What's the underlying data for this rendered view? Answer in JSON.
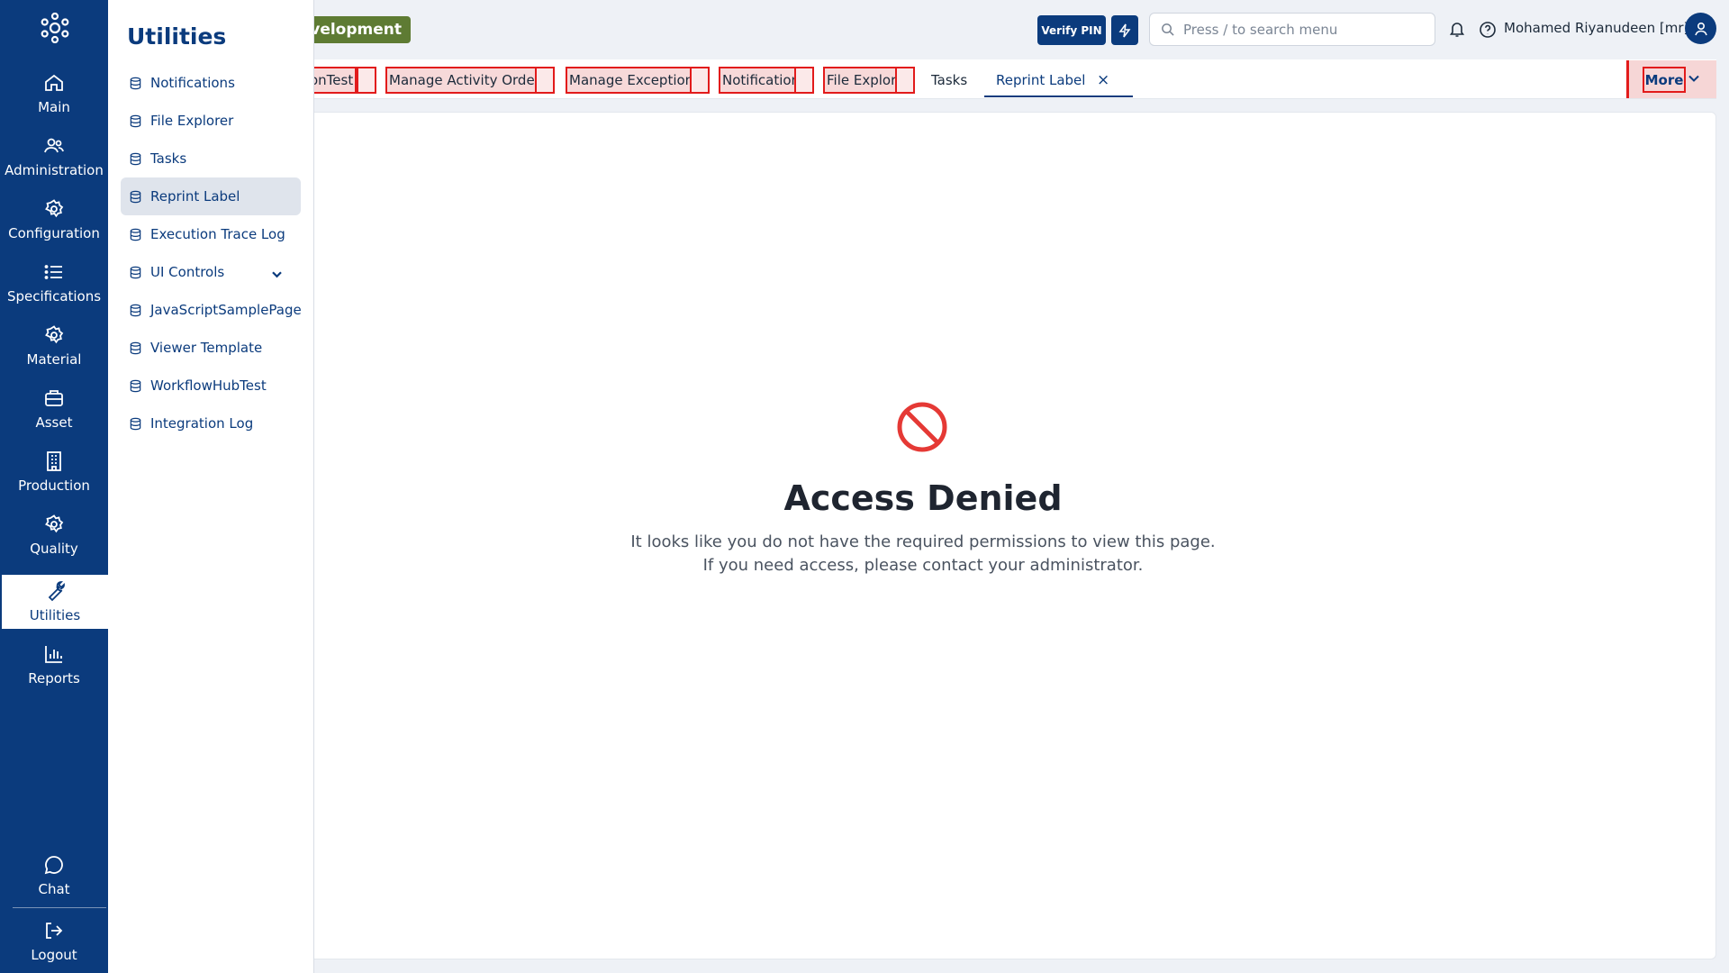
{
  "rail": {
    "items": [
      {
        "label": "Main",
        "icon": "home-icon"
      },
      {
        "label": "Administration",
        "icon": "users-icon"
      },
      {
        "label": "Configuration",
        "icon": "gear-icon"
      },
      {
        "label": "Specifications",
        "icon": "list-icon"
      },
      {
        "label": "Material",
        "icon": "gear-icon"
      },
      {
        "label": "Asset",
        "icon": "briefcase-icon"
      },
      {
        "label": "Production",
        "icon": "building-icon"
      },
      {
        "label": "Quality",
        "icon": "gear-icon"
      },
      {
        "label": "Utilities",
        "icon": "wrench-icon"
      },
      {
        "label": "Reports",
        "icon": "bar-chart-icon"
      },
      {
        "label": "Chat",
        "icon": "chat-icon"
      },
      {
        "label": "Logout",
        "icon": "logout-icon"
      }
    ],
    "active": "Utilities"
  },
  "flyout": {
    "title": "Utilities",
    "items": [
      {
        "label": "Notifications"
      },
      {
        "label": "File Explorer"
      },
      {
        "label": "Tasks"
      },
      {
        "label": "Reprint Label"
      },
      {
        "label": "Execution Trace Log"
      },
      {
        "label": "UI Controls"
      },
      {
        "label": "JavaScriptSamplePage"
      },
      {
        "label": "Viewer Template"
      },
      {
        "label": "WorkflowHubTest"
      },
      {
        "label": "Integration Log"
      }
    ],
    "active": "Reprint Label"
  },
  "header": {
    "env_badge": "evelopment",
    "verify_pin": "Verify PIN",
    "search_placeholder": "Press / to search menu",
    "user_name": "Mohamed Riyanudeen [mr]"
  },
  "tabs": {
    "items": [
      {
        "label": "onTest"
      },
      {
        "label": "Manage Activity Orders"
      },
      {
        "label": "Manage Exceptions"
      },
      {
        "label": "Notification"
      },
      {
        "label": "File Explorer"
      },
      {
        "label": "Tasks"
      },
      {
        "label": "Reprint Label"
      }
    ],
    "active": "Reprint Label",
    "close_glyph": "×",
    "more_label": "More"
  },
  "main": {
    "title": "Access Denied",
    "line1": "It looks like you do not have the required permissions to view this page.",
    "line2": "If you need access, please contact your administrator."
  },
  "colors": {
    "brand": "#0b3b7d",
    "highlight": "#e21b1b",
    "env_badge": "#5e7b33",
    "deny": "#e53935"
  }
}
